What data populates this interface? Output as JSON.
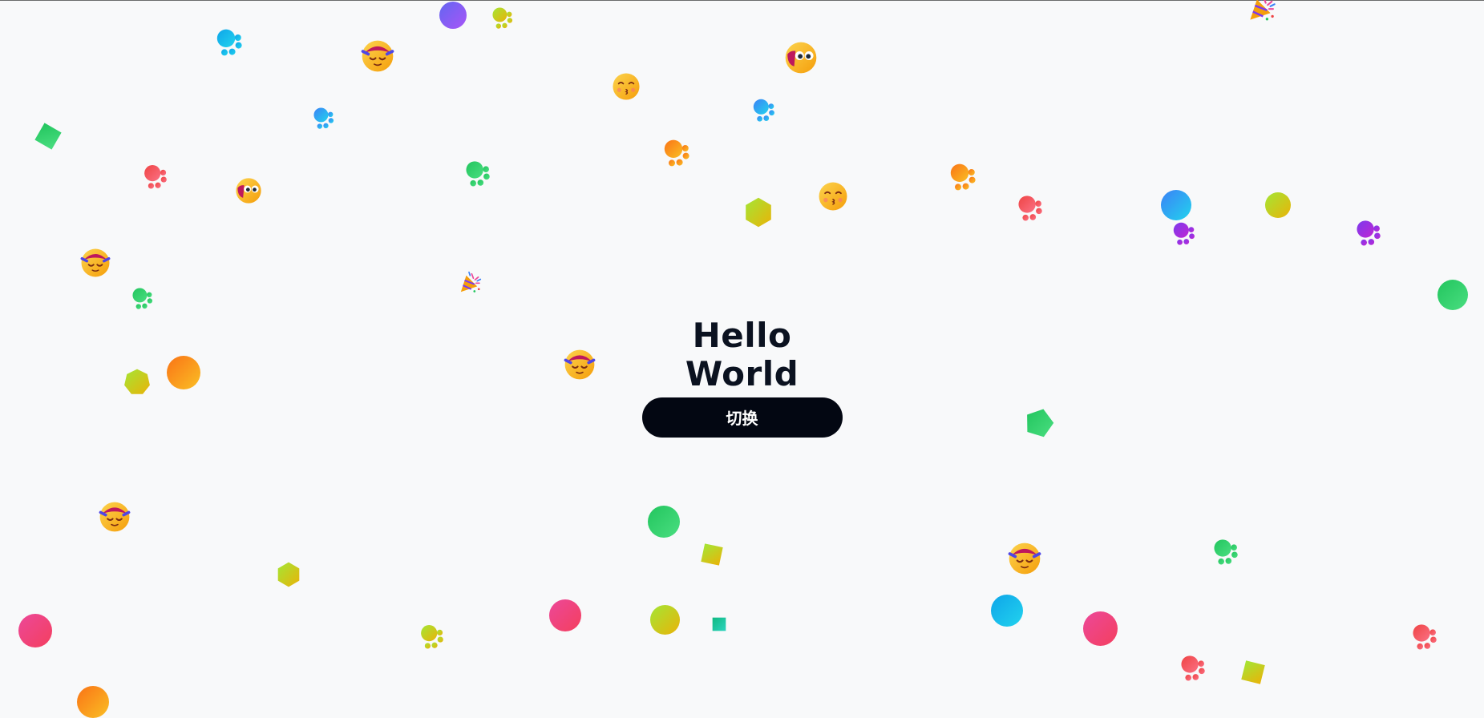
{
  "main": {
    "title": "Hello World",
    "toggle_label": "切换"
  },
  "confetti": {
    "icon_names": [
      "circle-icon",
      "paw-icon",
      "square-icon",
      "hexagon-icon",
      "pentagon-icon",
      "smiling-face-icon",
      "kissing-face-icon",
      "zany-face-icon",
      "party-popper-icon"
    ],
    "gradients": {
      "blue": [
        "#3b82f6",
        "#22d3ee"
      ],
      "cyan": [
        "#0ea5e9",
        "#22d3ee"
      ],
      "violet": [
        "#6366f1",
        "#a855f7"
      ],
      "purple": [
        "#7c3aed",
        "#c026d3"
      ],
      "lime": [
        "#a3e635",
        "#eab308"
      ],
      "green": [
        "#22c55e",
        "#4ade80"
      ],
      "teal": [
        "#10b981",
        "#2dd4bf"
      ],
      "red": [
        "#ef4444",
        "#fb7185"
      ],
      "pink": [
        "#ec4899",
        "#f43f5e"
      ],
      "orange": [
        "#f97316",
        "#fbbf24"
      ]
    }
  }
}
